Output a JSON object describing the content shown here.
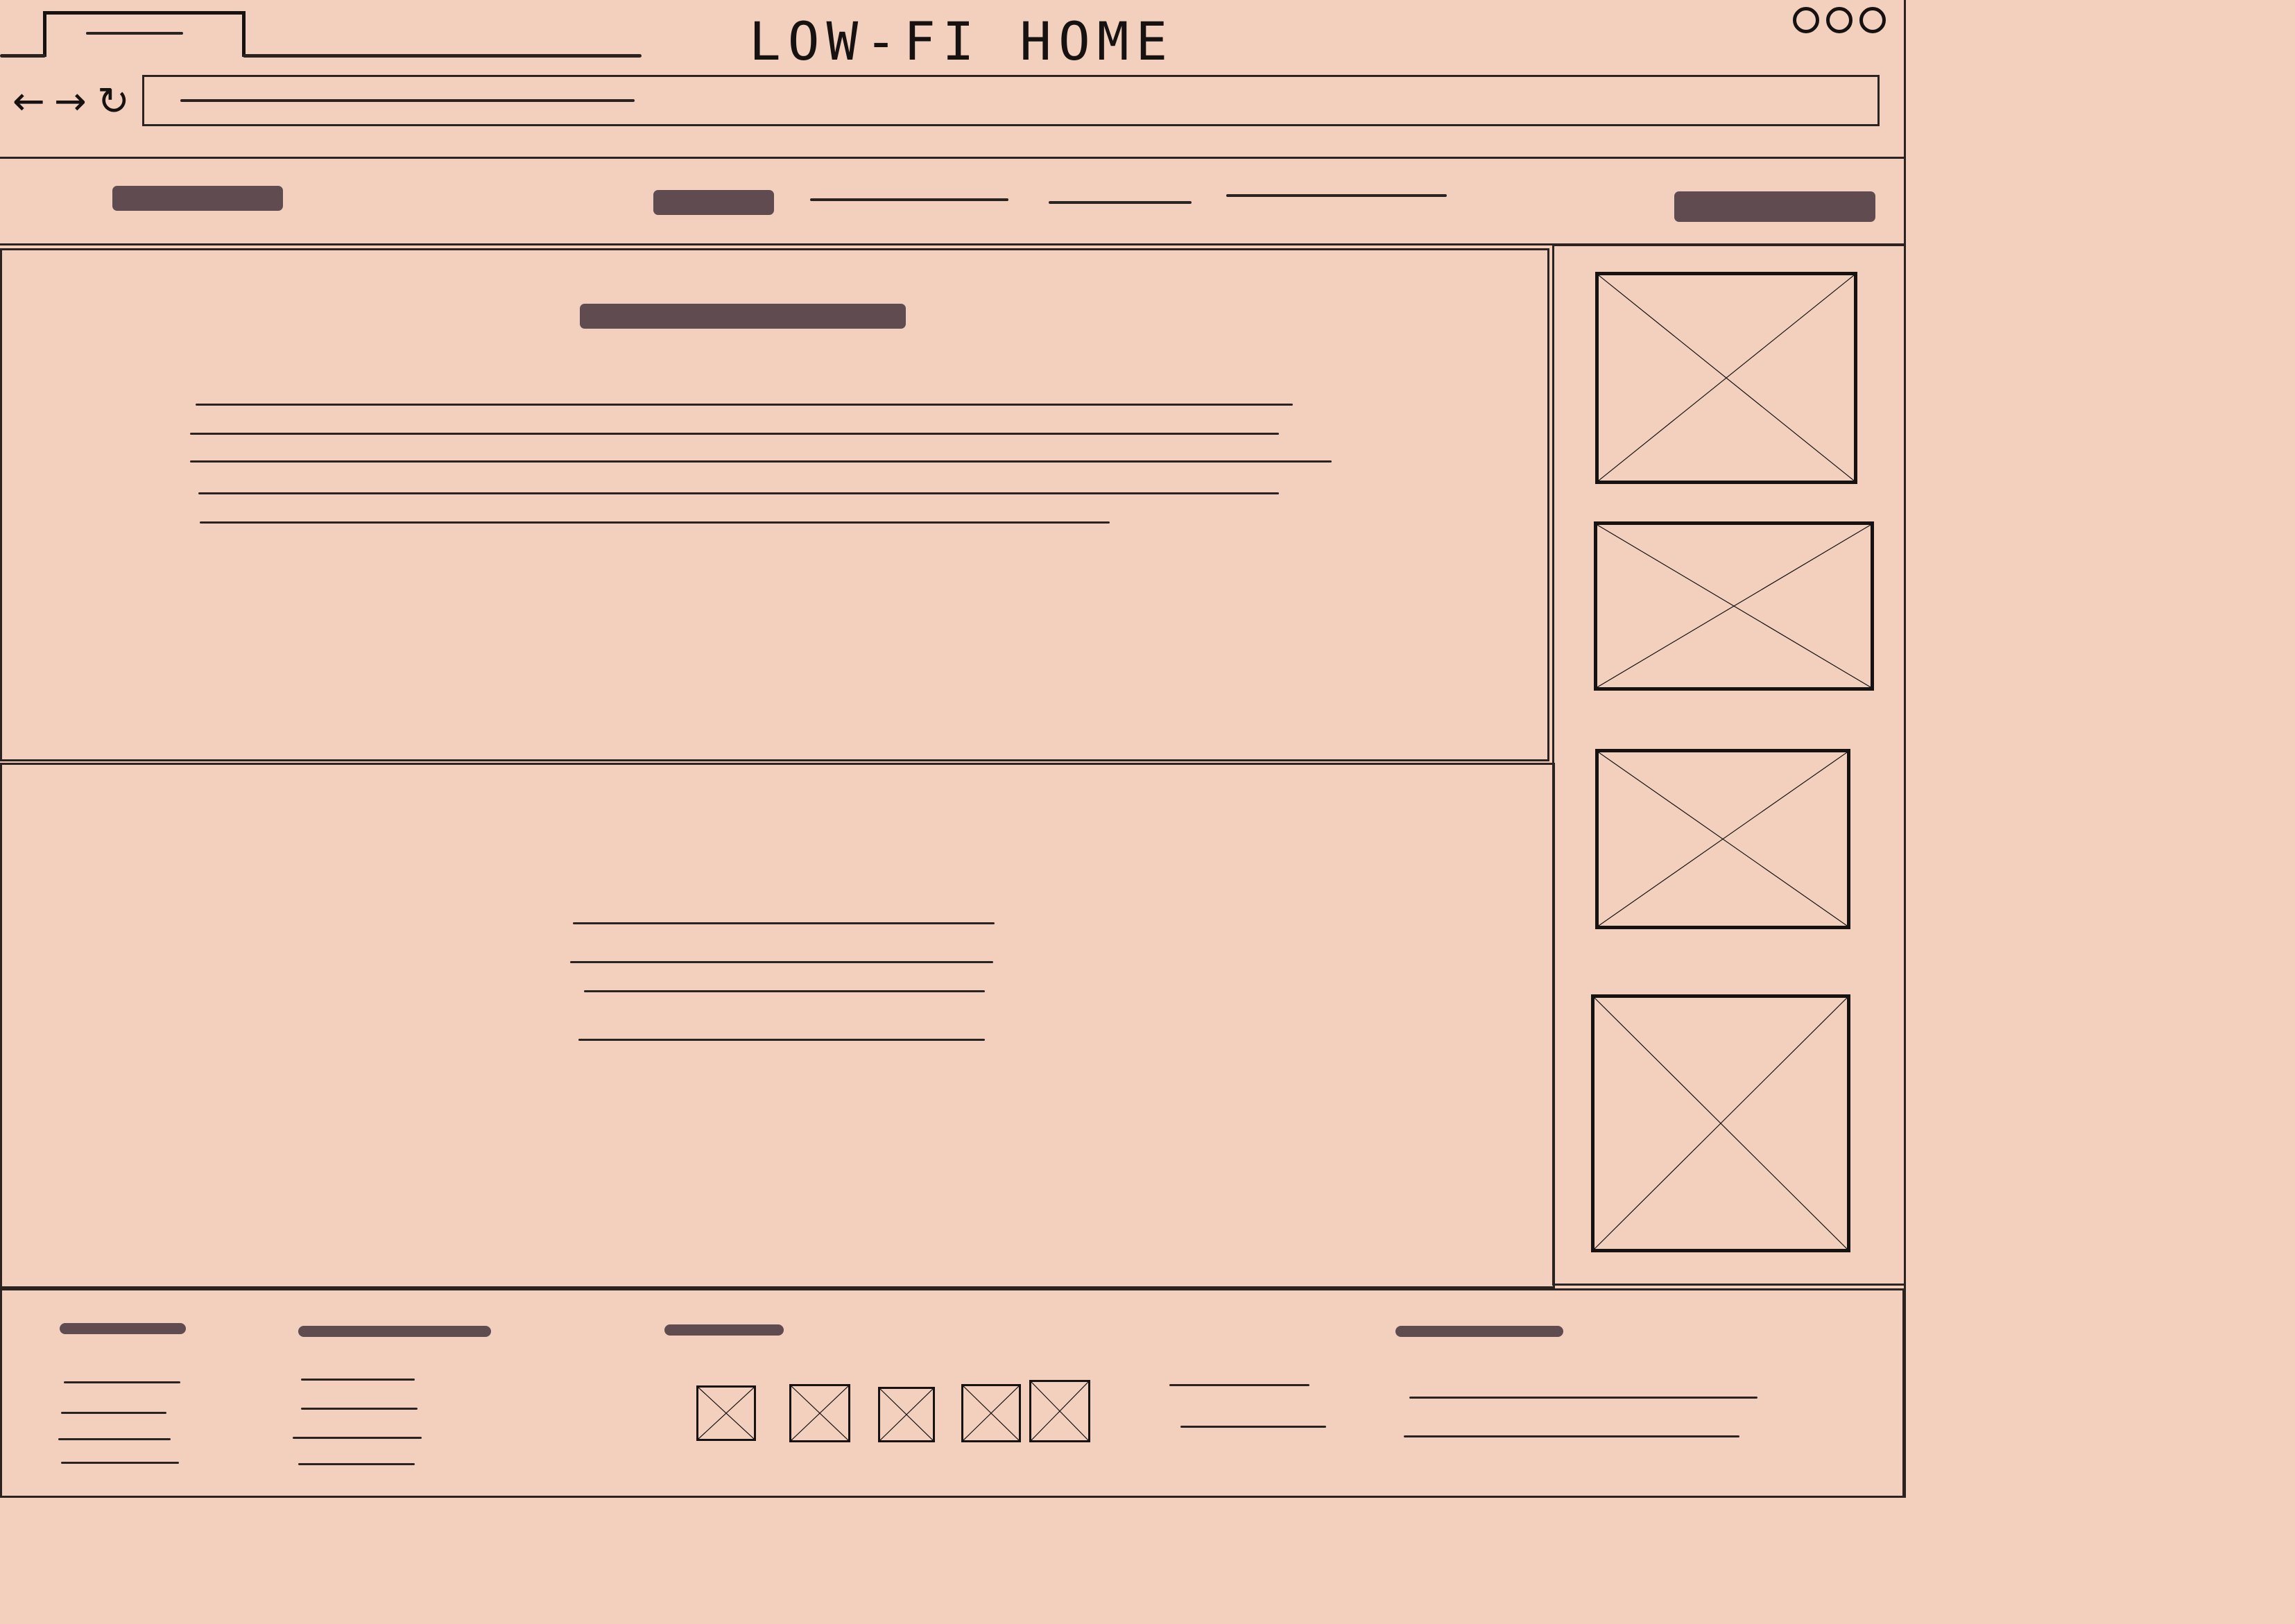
{
  "window": {
    "title": "LOW-FI HOME",
    "controls": [
      "window-dot-icon",
      "window-dot-icon",
      "window-dot-icon"
    ]
  },
  "toolbar": {
    "back_icon": "←",
    "forward_icon": "→",
    "reload_icon": "↻"
  },
  "colors": {
    "background": "#f2d0bd",
    "ink": "#171212",
    "placeholder_bar": "#5f4b50"
  }
}
